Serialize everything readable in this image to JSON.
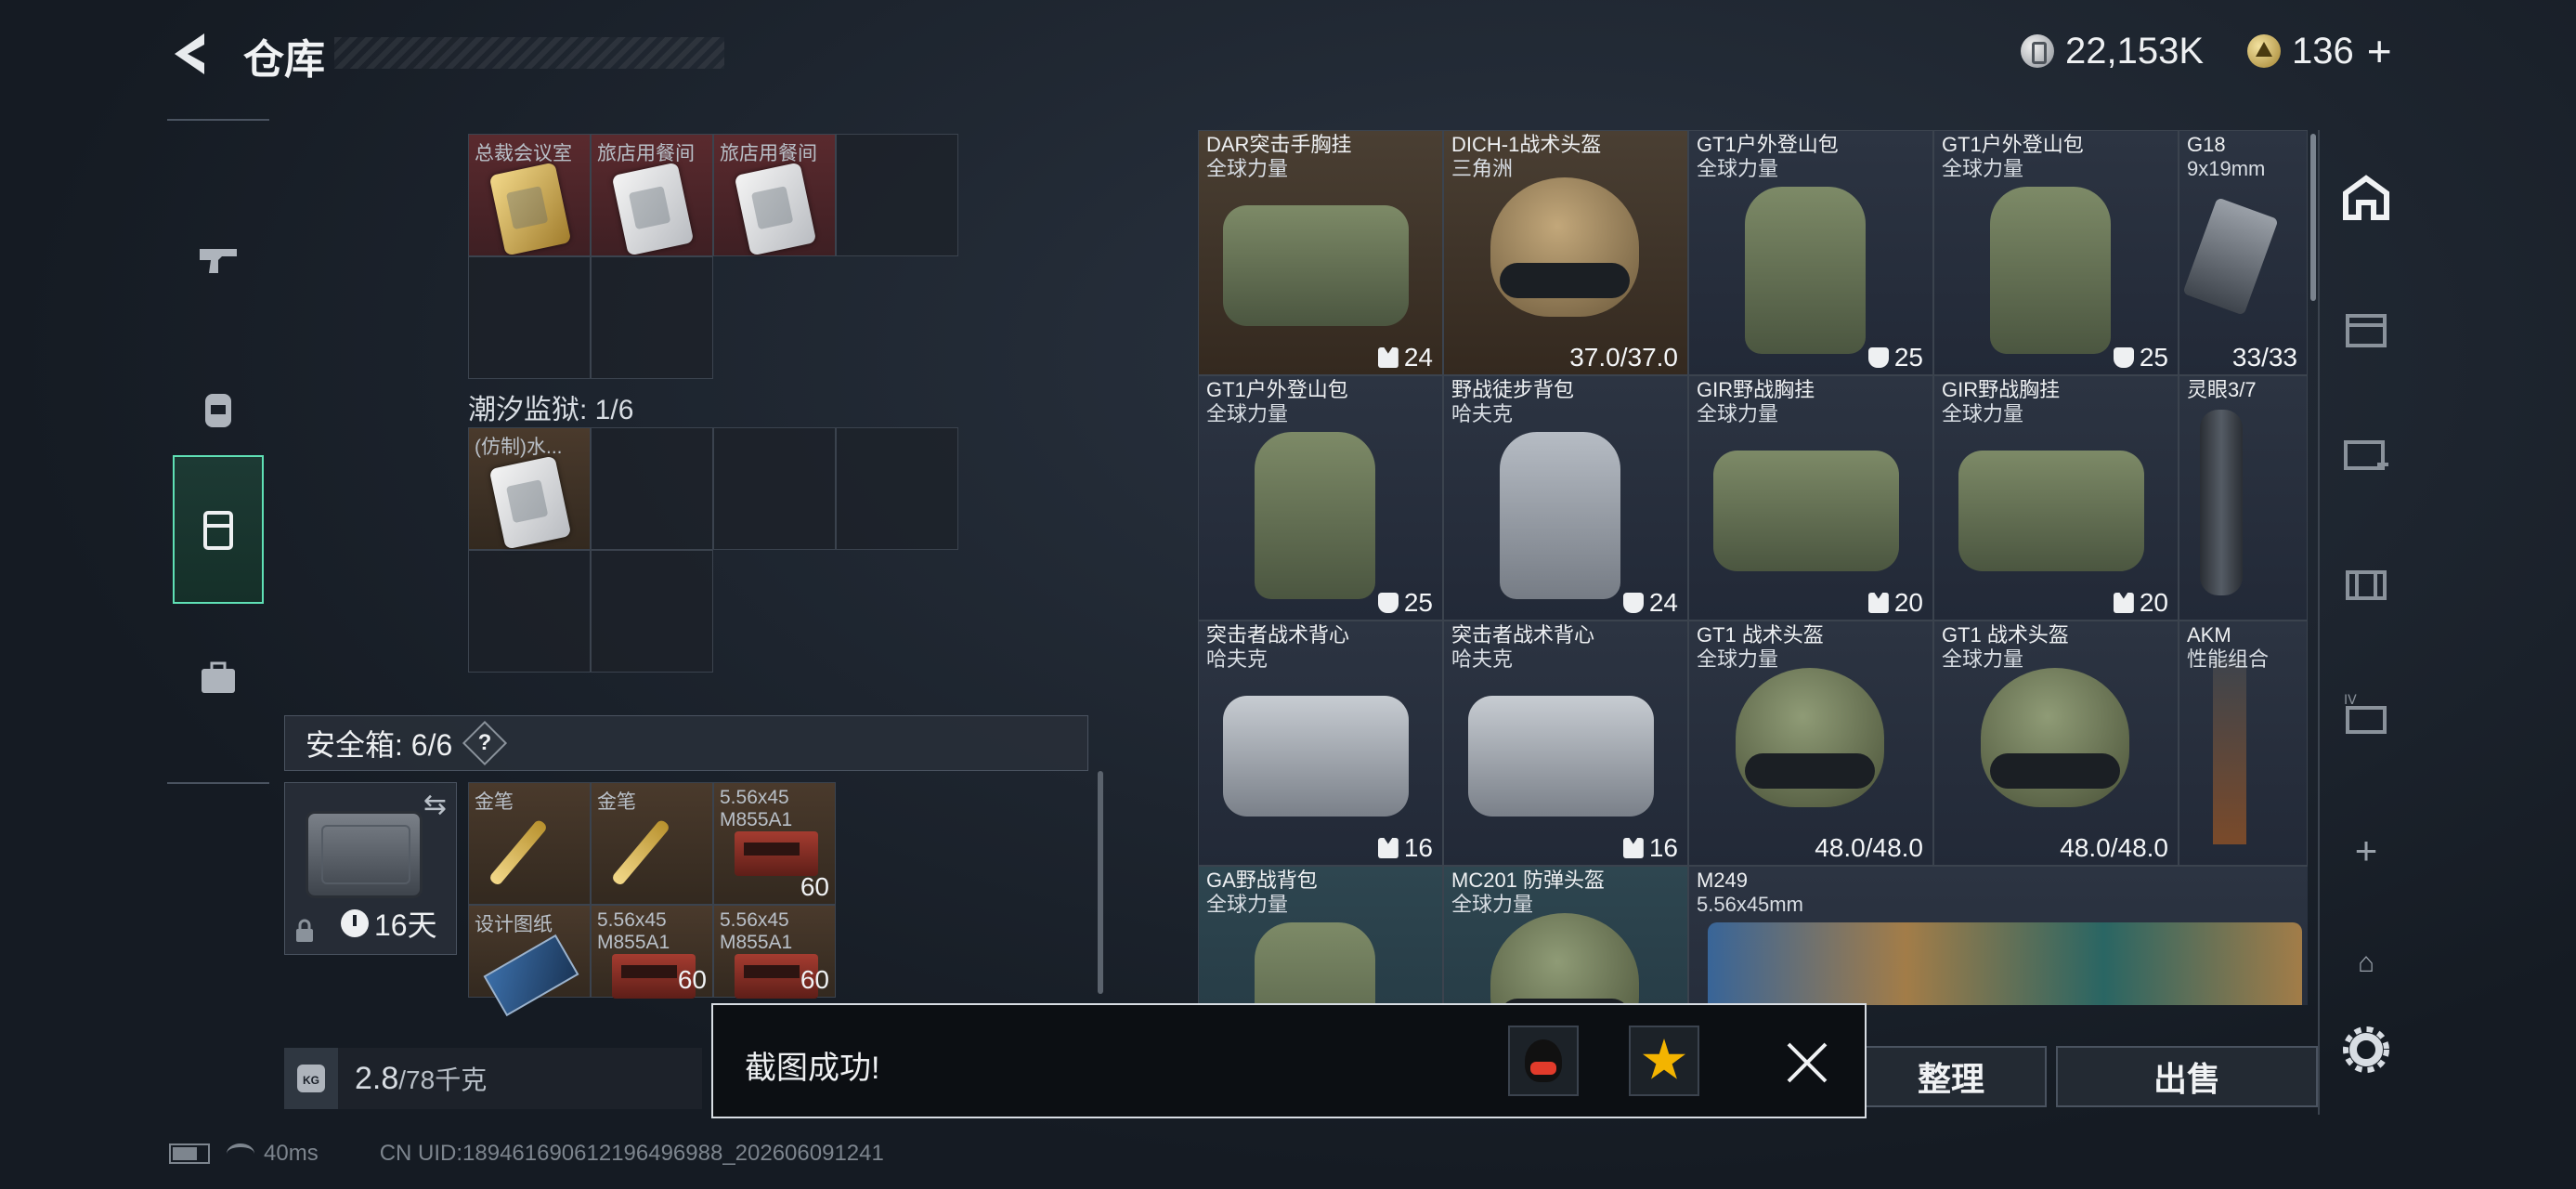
{
  "header": {
    "title": "仓库",
    "currency_silver": "22,153K",
    "currency_gold": "136",
    "plus": "+"
  },
  "left_grid": {
    "top_row": [
      {
        "label": "总裁会议室",
        "color": "gold"
      },
      {
        "label": "旅店用餐间",
        "color": "silver"
      },
      {
        "label": "旅店用餐间",
        "color": "silver"
      }
    ],
    "section2_label": "潮汐监狱: 1/6",
    "section2_item": {
      "label": "(仿制)水..."
    }
  },
  "safe": {
    "label": "安全箱: 6/6",
    "help": "?",
    "days": "16天",
    "items": [
      {
        "label": "金笔",
        "qty": ""
      },
      {
        "label": "金笔",
        "qty": ""
      },
      {
        "label": "5.56x45\nM855A1",
        "qty": "60"
      },
      {
        "label": "设计图纸",
        "qty": ""
      },
      {
        "label": "5.56x45\nM855A1",
        "qty": "60"
      },
      {
        "label": "5.56x45\nM855A1",
        "qty": "60"
      }
    ]
  },
  "weight": {
    "kg_icon": "KG",
    "current": "2.8",
    "total": "/78千克"
  },
  "inventory": [
    {
      "name": "DAR突击手胸挂",
      "sub": "全球力量",
      "value": "24",
      "kind": "rig",
      "bg": "brown"
    },
    {
      "name": "DICH-1战术头盔",
      "sub": "三角洲",
      "value": "37.0/37.0",
      "kind": "helmet-tan",
      "bg": "brown"
    },
    {
      "name": "GT1户外登山包",
      "sub": "全球力量",
      "value": "25",
      "kind": "bag",
      "bg": ""
    },
    {
      "name": "GT1户外登山包",
      "sub": "全球力量",
      "value": "25",
      "kind": "bag",
      "bg": ""
    },
    {
      "name": "G18",
      "sub": "9x19mm",
      "value": "33/33",
      "kind": "pistol",
      "bg": ""
    },
    {
      "name": "GT1户外登山包",
      "sub": "全球力量",
      "value": "25",
      "kind": "bag",
      "bg": ""
    },
    {
      "name": "野战徒步背包",
      "sub": "哈夫克",
      "value": "24",
      "kind": "bag-grey",
      "bg": ""
    },
    {
      "name": "GIR野战胸挂",
      "sub": "全球力量",
      "value": "20",
      "kind": "rig",
      "bg": ""
    },
    {
      "name": "GIR野战胸挂",
      "sub": "全球力量",
      "value": "20",
      "kind": "rig",
      "bg": ""
    },
    {
      "name": "灵眼3/7",
      "sub": "",
      "value": "",
      "kind": "scope",
      "bg": ""
    },
    {
      "name": "突击者战术背心",
      "sub": "哈夫克",
      "value": "16",
      "kind": "rig-grey",
      "bg": ""
    },
    {
      "name": "突击者战术背心",
      "sub": "哈夫克",
      "value": "16",
      "kind": "rig-grey",
      "bg": ""
    },
    {
      "name": "GT1 战术头盔",
      "sub": "全球力量",
      "value": "48.0/48.0",
      "kind": "helmet",
      "bg": ""
    },
    {
      "name": "GT1 战术头盔",
      "sub": "全球力量",
      "value": "48.0/48.0",
      "kind": "helmet",
      "bg": ""
    },
    {
      "name": "AKM",
      "sub": "性能组合",
      "value": "",
      "kind": "rifle",
      "bg": ""
    },
    {
      "name": "GA野战背包",
      "sub": "全球力量",
      "value": "",
      "kind": "bag",
      "bg": "teal"
    },
    {
      "name": "MC201 防弹头盔",
      "sub": "全球力量",
      "value": "",
      "kind": "helmet",
      "bg": "teal"
    },
    {
      "name": "M249",
      "sub": "5.56x45mm",
      "value": "",
      "kind": "mg",
      "bg": ""
    }
  ],
  "buttons": {
    "organize": "整理",
    "sell": "出售"
  },
  "toast": {
    "message": "截图成功!"
  },
  "status": {
    "ping": "40ms",
    "uid": "CN UID:18946169061219649698​8_202606091241"
  }
}
